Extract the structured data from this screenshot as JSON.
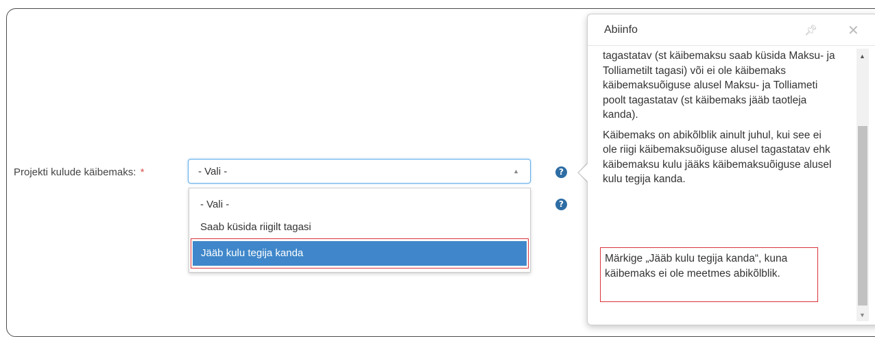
{
  "form": {
    "vat_label": "Projekti kulude käibemaks:",
    "required_mark": "*",
    "select": {
      "selected": "- Vali -",
      "options": [
        "- Vali -",
        "Saab küsida riigilt tagasi",
        "Jääb kulu tegija kanda"
      ],
      "highlighted_option": "Jääb kulu tegija kanda"
    },
    "help_icon_glyph": "?"
  },
  "help_popover": {
    "title": "Abiinfo",
    "paragraphs": [
      "tagastatav (st käibemaksu saab küsida Maksu- ja Tolliametilt tagasi) või ei ole käibemaks käibemaksuõiguse alusel Maksu- ja Tolliameti poolt tagastatav (st käibemaks jääb taotleja kanda).",
      "Käibemaks on abikõlblik ainult juhul, kui see ei ole riigi käibemaksuõiguse alusel tagastatav ehk käibemaksu kulu jääks käibemaksuõiguse alusel kulu tegija kanda."
    ],
    "note": "Märkige „Jääb kulu tegija kanda“, kuna käibemaks ei ole meetmes abikõlblik."
  },
  "colors": {
    "accent": "#3f87ca",
    "highlight_border": "#d9323a",
    "help_icon": "#2e6da4"
  },
  "icons": {
    "pin": "pin-icon",
    "close": "close-icon",
    "help": "question-circle-icon",
    "caret": "caret-up-icon"
  }
}
